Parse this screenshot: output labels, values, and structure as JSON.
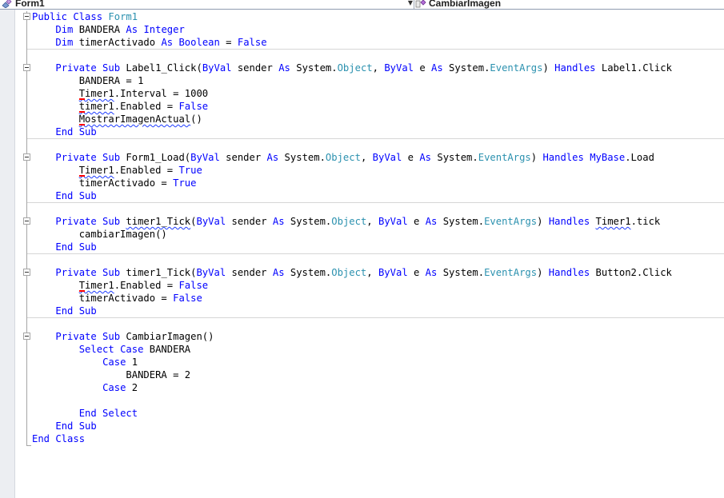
{
  "navbar": {
    "left_combo": "Form1",
    "right_combo": "CambiarImagen",
    "left_icon": "class-icon",
    "right_icon": "method-icon"
  },
  "code_lines": [
    [
      {
        "t": "Public Class ",
        "c": "kw"
      },
      {
        "t": "Form1",
        "c": "ty"
      }
    ],
    [
      {
        "t": "    "
      },
      {
        "t": "Dim",
        "c": "kw"
      },
      {
        "t": " BANDERA "
      },
      {
        "t": "As",
        "c": "kw"
      },
      {
        "t": " "
      },
      {
        "t": "Integer",
        "c": "kw"
      }
    ],
    [
      {
        "t": "    "
      },
      {
        "t": "Dim",
        "c": "kw"
      },
      {
        "t": " timerActivado "
      },
      {
        "t": "As",
        "c": "kw"
      },
      {
        "t": " "
      },
      {
        "t": "Boolean",
        "c": "kw"
      },
      {
        "t": " = "
      },
      {
        "t": "False",
        "c": "kw"
      }
    ],
    [],
    [
      {
        "t": "    "
      },
      {
        "t": "Private Sub",
        "c": "kw"
      },
      {
        "t": " Label1_Click("
      },
      {
        "t": "ByVal",
        "c": "kw"
      },
      {
        "t": " sender "
      },
      {
        "t": "As",
        "c": "kw"
      },
      {
        "t": " System."
      },
      {
        "t": "Object",
        "c": "ty"
      },
      {
        "t": ", "
      },
      {
        "t": "ByVal",
        "c": "kw"
      },
      {
        "t": " e "
      },
      {
        "t": "As",
        "c": "kw"
      },
      {
        "t": " System."
      },
      {
        "t": "EventArgs",
        "c": "ty"
      },
      {
        "t": ") "
      },
      {
        "t": "Handles",
        "c": "kw"
      },
      {
        "t": " Label1.Click"
      }
    ],
    [
      {
        "t": "        BANDERA = 1"
      }
    ],
    [
      {
        "t": "        "
      },
      {
        "t": "Timer1",
        "c": "sq err"
      },
      {
        "t": ".Interval = 1000"
      }
    ],
    [
      {
        "t": "        "
      },
      {
        "t": "timer1",
        "c": "sq err"
      },
      {
        "t": ".Enabled = "
      },
      {
        "t": "False",
        "c": "kw"
      }
    ],
    [
      {
        "t": "        "
      },
      {
        "t": "MostrarImagenActual",
        "c": "sq err"
      },
      {
        "t": "()"
      }
    ],
    [
      {
        "t": "    "
      },
      {
        "t": "End Sub",
        "c": "kw"
      }
    ],
    [],
    [
      {
        "t": "    "
      },
      {
        "t": "Private Sub",
        "c": "kw"
      },
      {
        "t": " Form1_Load("
      },
      {
        "t": "ByVal",
        "c": "kw"
      },
      {
        "t": " sender "
      },
      {
        "t": "As",
        "c": "kw"
      },
      {
        "t": " System."
      },
      {
        "t": "Object",
        "c": "ty"
      },
      {
        "t": ", "
      },
      {
        "t": "ByVal",
        "c": "kw"
      },
      {
        "t": " e "
      },
      {
        "t": "As",
        "c": "kw"
      },
      {
        "t": " System."
      },
      {
        "t": "EventArgs",
        "c": "ty"
      },
      {
        "t": ") "
      },
      {
        "t": "Handles",
        "c": "kw"
      },
      {
        "t": " "
      },
      {
        "t": "MyBase",
        "c": "kw"
      },
      {
        "t": ".Load"
      }
    ],
    [
      {
        "t": "        "
      },
      {
        "t": "Timer1",
        "c": "sq err"
      },
      {
        "t": ".Enabled = "
      },
      {
        "t": "True",
        "c": "kw"
      }
    ],
    [
      {
        "t": "        timerActivado = "
      },
      {
        "t": "True",
        "c": "kw"
      }
    ],
    [
      {
        "t": "    "
      },
      {
        "t": "End Sub",
        "c": "kw"
      }
    ],
    [],
    [
      {
        "t": "    "
      },
      {
        "t": "Private Sub",
        "c": "kw"
      },
      {
        "t": " "
      },
      {
        "t": "timer1_Tick",
        "c": "sq"
      },
      {
        "t": "("
      },
      {
        "t": "ByVal",
        "c": "kw"
      },
      {
        "t": " sender "
      },
      {
        "t": "As",
        "c": "kw"
      },
      {
        "t": " System."
      },
      {
        "t": "Object",
        "c": "ty"
      },
      {
        "t": ", "
      },
      {
        "t": "ByVal",
        "c": "kw"
      },
      {
        "t": " e "
      },
      {
        "t": "As",
        "c": "kw"
      },
      {
        "t": " System."
      },
      {
        "t": "EventArgs",
        "c": "ty"
      },
      {
        "t": ") "
      },
      {
        "t": "Handles",
        "c": "kw"
      },
      {
        "t": " "
      },
      {
        "t": "Timer1",
        "c": "sq"
      },
      {
        "t": ".tick"
      }
    ],
    [
      {
        "t": "        cambiarImagen()"
      }
    ],
    [
      {
        "t": "    "
      },
      {
        "t": "End Sub",
        "c": "kw"
      }
    ],
    [],
    [
      {
        "t": "    "
      },
      {
        "t": "Private Sub",
        "c": "kw"
      },
      {
        "t": " timer1_Tick("
      },
      {
        "t": "ByVal",
        "c": "kw"
      },
      {
        "t": " sender "
      },
      {
        "t": "As",
        "c": "kw"
      },
      {
        "t": " System."
      },
      {
        "t": "Object",
        "c": "ty"
      },
      {
        "t": ", "
      },
      {
        "t": "ByVal",
        "c": "kw"
      },
      {
        "t": " e "
      },
      {
        "t": "As",
        "c": "kw"
      },
      {
        "t": " System."
      },
      {
        "t": "EventArgs",
        "c": "ty"
      },
      {
        "t": ") "
      },
      {
        "t": "Handles",
        "c": "kw"
      },
      {
        "t": " Button2.Click"
      }
    ],
    [
      {
        "t": "        "
      },
      {
        "t": "Timer1",
        "c": "sq err"
      },
      {
        "t": ".Enabled = "
      },
      {
        "t": "False",
        "c": "kw"
      }
    ],
    [
      {
        "t": "        timerActivado = "
      },
      {
        "t": "False",
        "c": "kw"
      }
    ],
    [
      {
        "t": "    "
      },
      {
        "t": "End Sub",
        "c": "kw"
      }
    ],
    [],
    [
      {
        "t": "    "
      },
      {
        "t": "Private Sub",
        "c": "kw"
      },
      {
        "t": " CambiarImagen()"
      }
    ],
    [
      {
        "t": "        "
      },
      {
        "t": "Select Case",
        "c": "kw"
      },
      {
        "t": " BANDERA"
      }
    ],
    [
      {
        "t": "            "
      },
      {
        "t": "Case",
        "c": "kw"
      },
      {
        "t": " 1"
      }
    ],
    [
      {
        "t": "                BANDERA = 2"
      }
    ],
    [
      {
        "t": "            "
      },
      {
        "t": "Case",
        "c": "kw"
      },
      {
        "t": " 2"
      }
    ],
    [],
    [
      {
        "t": "        "
      },
      {
        "t": "End Select",
        "c": "kw"
      }
    ],
    [
      {
        "t": "    "
      },
      {
        "t": "End Sub",
        "c": "kw"
      }
    ],
    [
      {
        "t": "End Class",
        "c": "kw"
      }
    ]
  ],
  "colors": {
    "keyword": "#0000ff",
    "type": "#2b91af",
    "text": "#000000",
    "squiggle": "#1e3cff",
    "error_marker": "#ff0000"
  }
}
